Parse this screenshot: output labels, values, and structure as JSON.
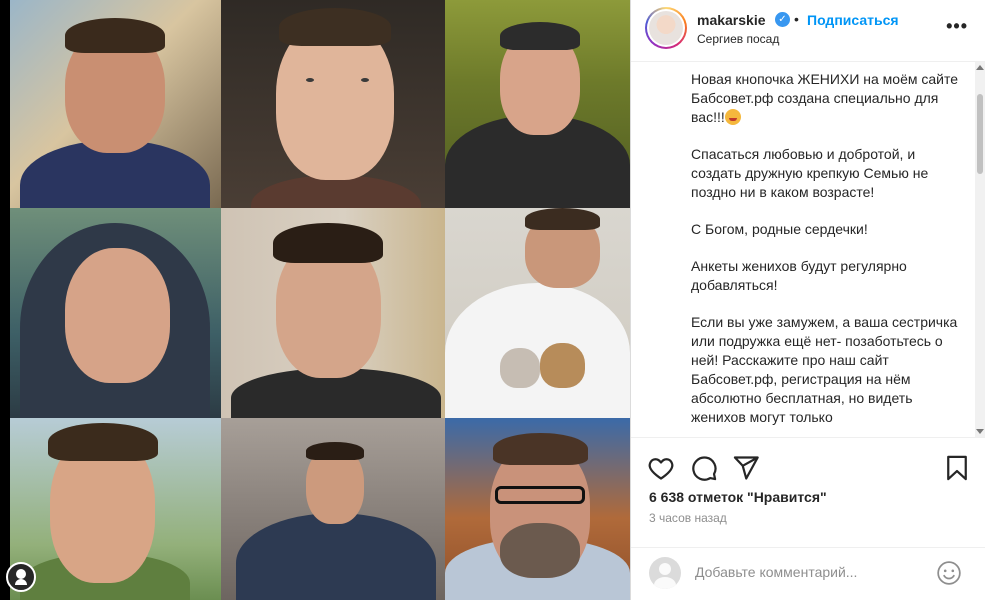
{
  "post": {
    "username": "makarskie",
    "verified_mark": "✓",
    "separator": "•",
    "follow_label": "Подписаться",
    "location": "Сергиев посад",
    "more_label": "•••"
  },
  "caption": {
    "paragraphs": [
      "Новая кнопочка ЖЕНИХИ на моём сайте Бабсовет.рф создана специально для вас!!!",
      "Спасаться любовью и добротой, и создать дружную крепкую Семью не поздно ни в каком возрасте!",
      "С Богом, родные сердечки!",
      "Анкеты женихов будут регулярно добавляться!",
      "Если вы уже замужем, а ваша сестричка или подружка ещё нет- позаботьтесь о ней! Расскажите про наш сайт Бабсовет.рф, регистрация на нём абсолютно бесплатная, но видеть женихов могут только"
    ]
  },
  "stats": {
    "likes": "6 638 отметок \"Нравится\"",
    "time": "3 часов назад"
  },
  "comment": {
    "placeholder": "Добавьте комментарий..."
  },
  "icons": [
    "heart-icon",
    "comment-icon",
    "share-icon",
    "bookmark-icon",
    "emoji-icon",
    "more-icon",
    "verified-icon"
  ],
  "colors": {
    "accent_blue": "#0095f6",
    "text_primary": "#262626",
    "text_secondary": "#8e8e8e",
    "border": "#efefef"
  }
}
